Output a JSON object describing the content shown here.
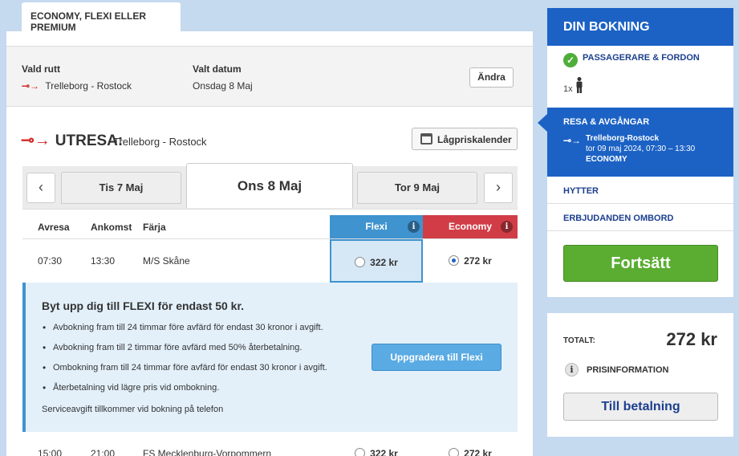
{
  "tab": {
    "label": "ECONOMY, FLEXI ELLER PREMIUM"
  },
  "route_bar": {
    "route_label": "Vald rutt",
    "route_value": "Trelleborg - Rostock",
    "date_label": "Valt datum",
    "date_value": "Onsdag 8 Maj",
    "change_button": "Ändra"
  },
  "outbound": {
    "title": "UTRESA:",
    "route": "Trelleborg - Rostock",
    "calendar_button": "Lågpriskalender"
  },
  "dates": {
    "prev": "Tis 7 Maj",
    "current": "Ons 8 Maj",
    "next": "Tor 9 Maj"
  },
  "columns": {
    "depart": "Avresa",
    "arrive": "Ankomst",
    "ferry": "Färja",
    "flexi": "Flexi",
    "economy": "Economy"
  },
  "departures": [
    {
      "depart": "07:30",
      "arrive": "13:30",
      "ferry": "M/S Skåne",
      "flexi_price": "322 kr",
      "economy_price": "272 kr"
    },
    {
      "depart": "15:00",
      "arrive": "21:00",
      "ferry": "FS Mecklenburg-Vorpommern",
      "flexi_price": "322 kr",
      "economy_price": "272 kr"
    }
  ],
  "upsell": {
    "title": "Byt upp dig till FLEXI för endast 50 kr.",
    "bullets": [
      "Avbokning fram till 24 timmar före avfärd för endast 30 kronor i avgift.",
      "Avbokning fram till 2 timmar före avfärd med 50% återbetalning.",
      "Ombokning fram till 24 timmar före avfärd för endast 30 kronor i avgift.",
      "Återbetalning vid lägre pris vid ombokning."
    ],
    "note": "Serviceavgift tillkommer vid bokning på telefon",
    "button": "Uppgradera till Flexi"
  },
  "sidebar": {
    "title": "DIN BOKNING",
    "step_passengers": "PASSAGERARE & FORDON",
    "pax_count": "1x",
    "step_trip": "RESA & AVGÅNGAR",
    "trip_route": "Trelleborg-Rostock",
    "trip_time": "tor 09 maj 2024, 07:30 – 13:30",
    "trip_class": "ECONOMY",
    "link_cabins": "HYTTER",
    "link_offers": "ERBJUDANDEN OMBORD",
    "continue_button": "Fortsätt"
  },
  "totals": {
    "label": "TOTALT:",
    "value": "272 kr",
    "price_info": "PRISINFORMATION",
    "pay_button": "Till betalning"
  },
  "colors": {
    "blue": "#1c62c5",
    "flexi": "#3f93cf",
    "economy": "#d13d47",
    "green": "#5aad31"
  }
}
